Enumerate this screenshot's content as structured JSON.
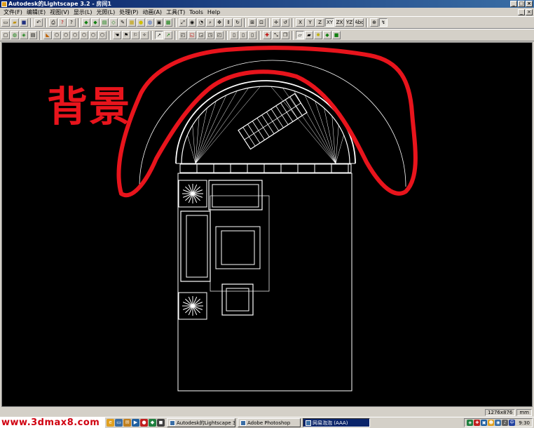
{
  "window": {
    "title": "Autodesk的Lightscape 3.2 - 房间1",
    "minimize": "_",
    "maximize": "□",
    "close": "×"
  },
  "menu": [
    {
      "name": "menu-file",
      "label": "文件(F)"
    },
    {
      "name": "menu-edit",
      "label": "编辑(E)"
    },
    {
      "name": "menu-view",
      "label": "视图(V)"
    },
    {
      "name": "menu-display",
      "label": "显示(L)"
    },
    {
      "name": "menu-light",
      "label": "光照(L)"
    },
    {
      "name": "menu-process",
      "label": "处理(P)"
    },
    {
      "name": "menu-animation",
      "label": "动画(A)"
    },
    {
      "name": "menu-tools-cn",
      "label": "工具(T)"
    },
    {
      "name": "menu-tools",
      "label": "Tools"
    },
    {
      "name": "menu-help",
      "label": "Help"
    }
  ],
  "toolbar": {
    "axis_x": "X",
    "axis_y": "Y",
    "axis_z": "Z",
    "axis_xy": "XY",
    "axis_zx": "ZX",
    "axis_yz": "YZ",
    "axis_abc": "Abc"
  },
  "canvas": {
    "background_label": "背景",
    "label_color": "#e8141c",
    "wire_color": "#ffffff"
  },
  "status": {
    "resolution": "1276x876",
    "unit": "mm"
  },
  "taskbar": {
    "watermark": "www.3dmax8.com",
    "tasks": [
      {
        "label": "Autodesk的Lightscape 3....",
        "active": false
      },
      {
        "label": "Adobe Photoshop",
        "active": false
      },
      {
        "label": "网易泡泡 (AAA)",
        "active": true
      }
    ],
    "clock": "9:30"
  },
  "colors": {
    "face": "#d4d0c8",
    "title_start": "#0a246a",
    "title_end": "#3a6ea5",
    "watermark": "#d00010"
  }
}
